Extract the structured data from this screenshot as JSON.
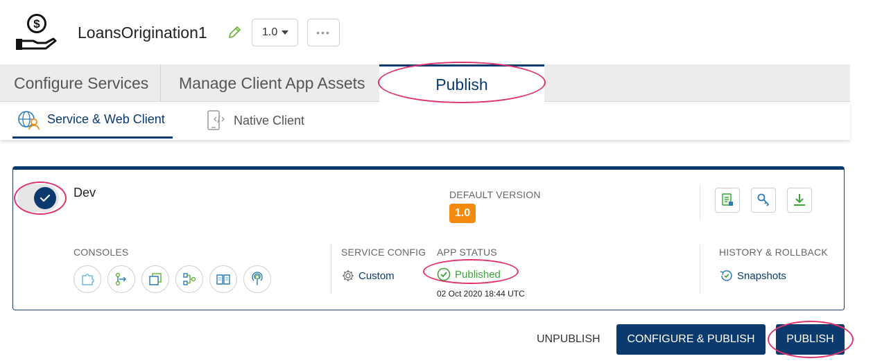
{
  "app": {
    "title": "LoansOrigination1",
    "version": "1.0",
    "more_label": "•••"
  },
  "tabs": [
    {
      "label": "Configure Services",
      "active": false
    },
    {
      "label": "Manage Client App Assets",
      "active": false
    },
    {
      "label": "Publish",
      "active": true
    }
  ],
  "subtabs": [
    {
      "label": "Service & Web Client",
      "active": true
    },
    {
      "label": "Native Client",
      "active": false
    }
  ],
  "environment": {
    "name": "Dev",
    "enabled": true,
    "default_version_label": "DEFAULT VERSION",
    "default_version": "1.0",
    "consoles_label": "CONSOLES",
    "consoles": [
      "identity-console-icon",
      "integration-console-icon",
      "objects-console-icon",
      "orchestration-console-icon",
      "api-docs-console-icon",
      "engagement-console-icon"
    ],
    "service_config_label": "SERVICE CONFIG",
    "service_config_value": "Custom",
    "app_status_label": "APP STATUS",
    "app_status_value": "Published",
    "app_status_time": "02 Oct 2020 18:44 UTC",
    "history_label": "HISTORY & ROLLBACK",
    "history_value": "Snapshots",
    "actions": [
      "app-config-icon",
      "key-icon",
      "download-icon"
    ]
  },
  "footer": {
    "unpublish_label": "UNPUBLISH",
    "configure_publish_label": "CONFIGURE & PUBLISH",
    "publish_label": "PUBLISH"
  },
  "colors": {
    "primary": "#0b3a6e",
    "badge": "#f28a10",
    "success": "#3aa53a",
    "highlight": "#e0336e"
  }
}
